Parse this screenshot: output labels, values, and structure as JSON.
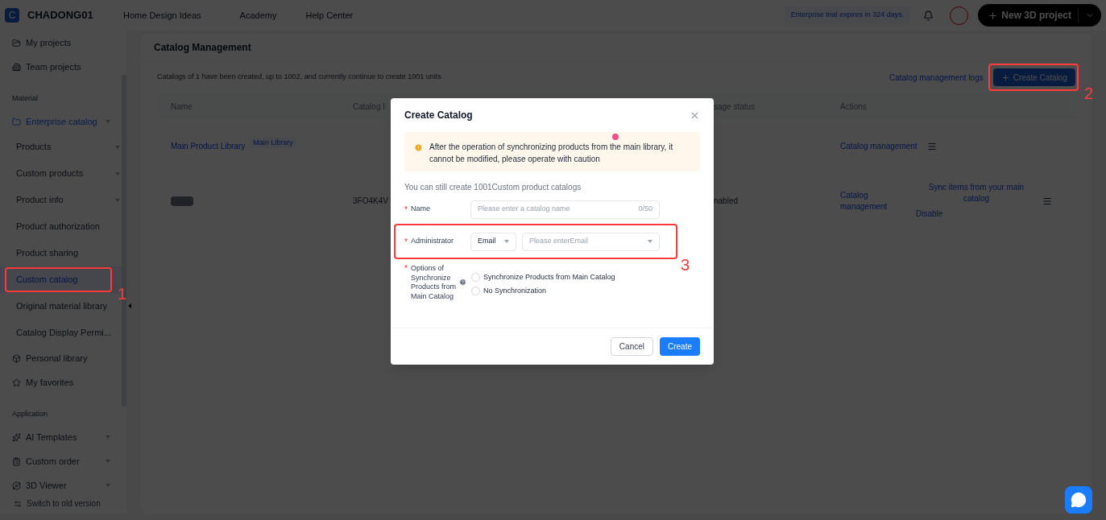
{
  "header": {
    "logo_letter": "C",
    "workspace": "CHADONG01",
    "nav": [
      "Home Design Ideas",
      "Academy",
      "Help Center"
    ],
    "trial_notice": "Enterprise trial expires in 324 days.",
    "new_project_button": "New 3D project"
  },
  "sidebar": {
    "items": [
      {
        "kind": "link",
        "label": "My projects",
        "selected": false,
        "expandable": false,
        "expanded": false
      },
      {
        "kind": "link",
        "label": "Team projects",
        "selected": false,
        "expandable": false,
        "expanded": false
      },
      {
        "kind": "heading",
        "label": "Material"
      },
      {
        "kind": "link",
        "label": "Enterprise catalog",
        "selected": false,
        "expandable": true,
        "expanded": true,
        "children": [
          {
            "label": "Products",
            "selected": false,
            "expandable": true
          },
          {
            "label": "Custom products",
            "selected": false,
            "expandable": true
          },
          {
            "label": "Product info",
            "selected": false,
            "expandable": true
          },
          {
            "label": "Product authorization",
            "selected": false,
            "expandable": false
          },
          {
            "label": "Product sharing",
            "selected": false,
            "expandable": false
          },
          {
            "label": "Custom catalog",
            "selected": true,
            "expandable": false,
            "annotation": "1"
          },
          {
            "label": "Original material library",
            "selected": false,
            "expandable": false
          },
          {
            "label": "Catalog Display Permi...",
            "selected": false,
            "expandable": false
          }
        ]
      },
      {
        "kind": "link",
        "label": "Personal library",
        "selected": false,
        "expandable": false,
        "expanded": false
      },
      {
        "kind": "link",
        "label": "My favorites",
        "selected": false,
        "expandable": false,
        "expanded": false
      },
      {
        "kind": "heading",
        "label": "Application"
      },
      {
        "kind": "link",
        "label": "AI Templates",
        "selected": false,
        "expandable": true,
        "expanded": false
      },
      {
        "kind": "link",
        "label": "Custom order",
        "selected": false,
        "expandable": true,
        "expanded": false
      },
      {
        "kind": "link",
        "label": "3D Viewer",
        "selected": false,
        "expandable": true,
        "expanded": false
      }
    ],
    "footer_link": "Switch to old version"
  },
  "page": {
    "title": "Catalog Management",
    "summary": "Catalogs of 1 have been created, up to 1002, and currently continue to create 1001 units",
    "logs_link": "Catalog management logs",
    "create_button": {
      "label": "Create Catalog",
      "annotation": "2"
    },
    "table": {
      "columns": [
        "Name",
        "Catalog I",
        "sage status",
        "Actions"
      ],
      "rows": [
        {
          "name": "Main Product Library",
          "redacted": false,
          "tag": "Main Library",
          "catalog_id": "",
          "status": "",
          "actions": [
            "Catalog management"
          ]
        },
        {
          "name": "",
          "redacted": true,
          "catalog_id": "3FO4K4V",
          "status": "nabled",
          "actions": [
            "Catalog management",
            "Sync items from your main catalog",
            "Disable"
          ]
        }
      ]
    }
  },
  "dialog": {
    "title": "Create Catalog",
    "warning": "After the operation of synchronizing products from the main library, it cannot be modified, please operate with caution",
    "remaining": "You can still create 1001Custom product catalogs",
    "fields": [
      {
        "kind": "text",
        "label": "Name",
        "required_mark": "*",
        "placeholder": "Please enter a catalog name",
        "counter": "0/50"
      },
      {
        "kind": "select",
        "label": "Administrator",
        "required_mark": "*",
        "type_value": "Email",
        "placeholder": "Please enterEmail",
        "annotation": "3"
      },
      {
        "kind": "radio",
        "label": "Options of Synchronize Products from Main Catalog",
        "required_mark": "*",
        "options": [
          {
            "label": "Synchronize Products from Main Catalog",
            "selected": false
          },
          {
            "label": "No Synchronization",
            "selected": false
          }
        ]
      }
    ],
    "buttons": [
      "Cancel",
      "Create"
    ]
  }
}
